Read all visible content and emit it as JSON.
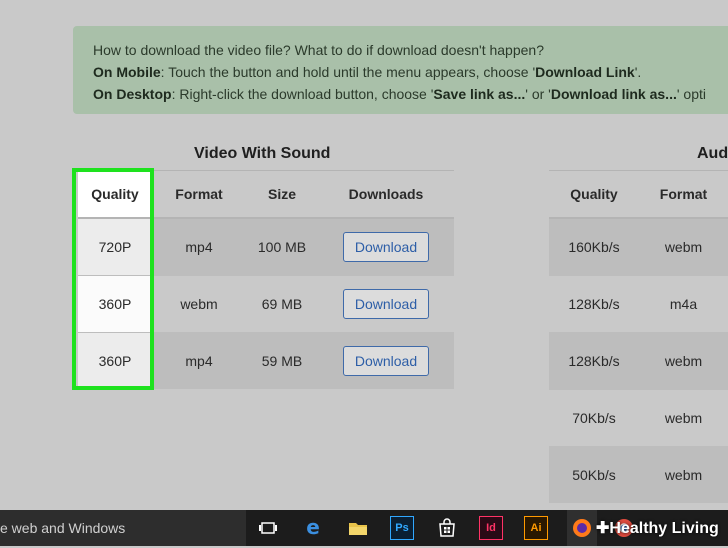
{
  "info": {
    "question": "How to download the video file? What to do if download doesn't happen?",
    "mobile_label": "On Mobile",
    "mobile_text_1": ": Touch the button and hold until the menu appears, choose '",
    "mobile_bold": "Download Link",
    "mobile_text_2": "'.",
    "desktop_label": "On Desktop",
    "desktop_text_1": ": Right-click the download button, choose '",
    "desktop_bold_1": "Save link as...",
    "desktop_text_2": "' or '",
    "desktop_bold_2": "Download link as...",
    "desktop_text_3": "' opti"
  },
  "video": {
    "title": "Video With Sound",
    "headers": [
      "Quality",
      "Format",
      "Size",
      "Downloads"
    ],
    "rows": [
      {
        "quality": "720P",
        "format": "mp4",
        "size": "100 MB",
        "button": "Download"
      },
      {
        "quality": "360P",
        "format": "webm",
        "size": "69 MB",
        "button": "Download"
      },
      {
        "quality": "360P",
        "format": "mp4",
        "size": "59 MB",
        "button": "Download"
      }
    ]
  },
  "audio": {
    "title": "Aud",
    "headers": [
      "Quality",
      "Format"
    ],
    "rows": [
      {
        "quality": "160Kb/s",
        "format": "webm"
      },
      {
        "quality": "128Kb/s",
        "format": "m4a"
      },
      {
        "quality": "128Kb/s",
        "format": "webm"
      },
      {
        "quality": "70Kb/s",
        "format": "webm"
      },
      {
        "quality": "50Kb/s",
        "format": "webm"
      }
    ]
  },
  "taskbar": {
    "search_text": "e web and Windows",
    "icons": [
      {
        "name": "task-view-icon",
        "label": "",
        "color": "#ffffff"
      },
      {
        "name": "edge-icon",
        "label": "e",
        "color": "#3b8fe0"
      },
      {
        "name": "file-explorer-icon",
        "label": "",
        "color": "#e8c34a"
      },
      {
        "name": "photoshop-icon",
        "label": "Ps",
        "color": "#31a8ff"
      },
      {
        "name": "store-icon",
        "label": "",
        "color": "#ffffff"
      },
      {
        "name": "indesign-icon",
        "label": "Id",
        "color": "#ff3366"
      },
      {
        "name": "illustrator-icon",
        "label": "Ai",
        "color": "#ff9a00"
      },
      {
        "name": "firefox-icon",
        "label": "",
        "color": "#ff7a1a"
      }
    ]
  },
  "watermark": "Healthy Living",
  "colors": {
    "highlight": "#1ee21e",
    "button_text": "#2d5ea7",
    "info_bg": "#a9c0a9"
  }
}
